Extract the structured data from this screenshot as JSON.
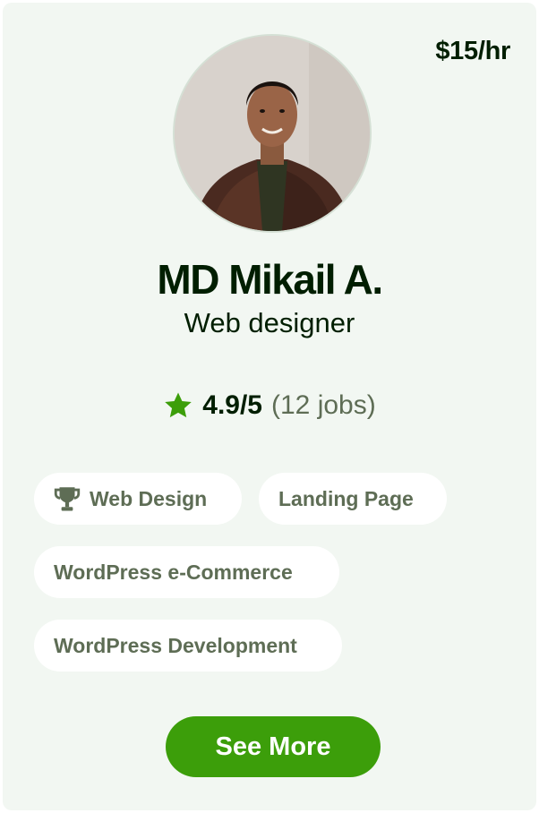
{
  "profile": {
    "rate": "$15/hr",
    "name": "MD Mikail A.",
    "title": "Web designer",
    "rating_score": "4.9/5",
    "rating_jobs": "(12 jobs)"
  },
  "skills": [
    {
      "label": "Web Design",
      "icon": "trophy-icon"
    },
    {
      "label": "Landing Page"
    },
    {
      "label": "WordPress e-Commerce"
    },
    {
      "label": "WordPress Development"
    }
  ],
  "actions": {
    "see_more_label": "See More"
  },
  "colors": {
    "card_background": "#f2f7f2",
    "accent_green": "#3c9e0a",
    "text_dark": "#001e00",
    "text_muted": "#5e6d55"
  }
}
